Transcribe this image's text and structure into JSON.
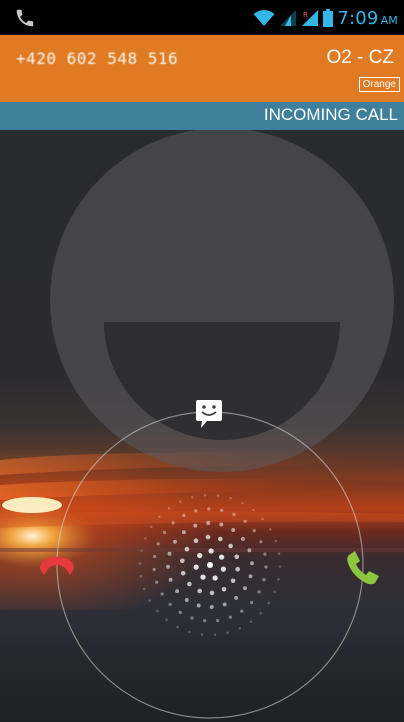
{
  "status_bar": {
    "time": "7:09",
    "am_pm": "AM",
    "icons": [
      "call-in-progress-icon",
      "wifi-icon",
      "signal-icon",
      "roaming-signal-icon",
      "battery-icon"
    ],
    "accent_color": "#33b5e5"
  },
  "caller": {
    "number": "+420 602 548 516",
    "carrier": "O2 - CZ",
    "network_label": "Orange",
    "header_color": "#e07b23"
  },
  "call_state": {
    "label": "INCOMING CALL",
    "bar_color": "#3e7f9c"
  },
  "glowpad": {
    "targets": [
      {
        "name": "decline",
        "icon": "phone-hangup-icon",
        "color": "#e5393d"
      },
      {
        "name": "answer",
        "icon": "phone-answer-icon",
        "color": "#8cc63f"
      },
      {
        "name": "reply-sms",
        "icon": "message-smiley-icon",
        "color": "#ffffff"
      }
    ]
  }
}
